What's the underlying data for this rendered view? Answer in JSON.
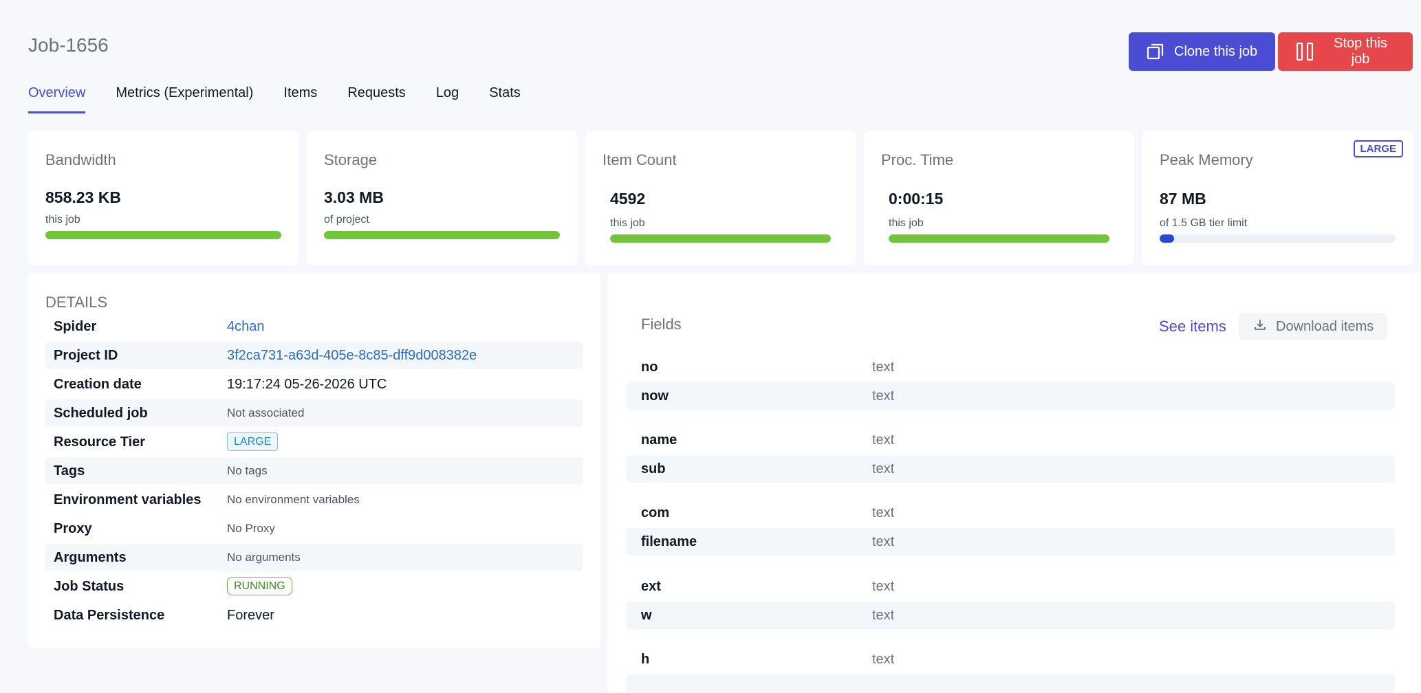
{
  "header": {
    "title": "Job-1656",
    "clone_label": "Clone this job",
    "stop_label": "Stop this job"
  },
  "tabs": [
    {
      "label": "Overview",
      "active": true
    },
    {
      "label": "Metrics (Experimental)"
    },
    {
      "label": "Items"
    },
    {
      "label": "Requests"
    },
    {
      "label": "Log"
    },
    {
      "label": "Stats"
    }
  ],
  "stats": {
    "bandwidth": {
      "title": "Bandwidth",
      "value": "858.23 KB",
      "sub": "this job",
      "progress": 1.0
    },
    "storage": {
      "title": "Storage",
      "value": "3.03 MB",
      "sub": "of project",
      "progress": 1.0
    },
    "item_count": {
      "title": "Item Count",
      "value": "4592",
      "sub": "this job",
      "progress": 1.0
    },
    "proc_time": {
      "title": "Proc. Time",
      "value": "0:00:15",
      "sub": "this job",
      "progress": 1.0
    },
    "peak_memory": {
      "title": "Peak Memory",
      "value": "87 MB",
      "sub": "of 1.5 GB tier limit",
      "progress": 0.06,
      "badge": "LARGE"
    }
  },
  "details": {
    "title": "DETAILS",
    "rows": [
      {
        "label": "Spider",
        "value": "4chan"
      },
      {
        "label": "Project ID",
        "value": "3f2ca731-a63d-405e-8c85-dff9d008382e"
      },
      {
        "label": "Creation date",
        "value": "19:17:24 05-26-2026 UTC"
      },
      {
        "label": "Scheduled job",
        "value": "Not associated"
      },
      {
        "label": "Resource Tier",
        "value": "LARGE"
      },
      {
        "label": "Tags",
        "value": "No tags"
      },
      {
        "label": "Environment variables",
        "value": "No environment variables"
      },
      {
        "label": "Proxy",
        "value": "No Proxy"
      },
      {
        "label": "Arguments",
        "value": "No arguments"
      },
      {
        "label": "Job Status",
        "value": "RUNNING"
      },
      {
        "label": "Data Persistence",
        "value": "Forever"
      }
    ]
  },
  "fields": {
    "title": "Fields",
    "see_items_label": "See items",
    "download_label": "Download items",
    "rows": [
      {
        "name": "no",
        "type": "text"
      },
      {
        "name": "now",
        "type": "text"
      },
      {
        "name": "name",
        "type": "text"
      },
      {
        "name": "sub",
        "type": "text"
      },
      {
        "name": "com",
        "type": "text"
      },
      {
        "name": "filename",
        "type": "text"
      },
      {
        "name": "ext",
        "type": "text"
      },
      {
        "name": "w",
        "type": "text"
      },
      {
        "name": "h",
        "type": "text"
      }
    ]
  },
  "colors": {
    "accent": "#4a4dd4",
    "danger": "#e5474a",
    "progress_green": "#72c53a",
    "progress_blue": "#2945d1",
    "running_green": "#3c8a26"
  },
  "icons": {
    "clone": "clone-icon",
    "stop": "stop-icon",
    "download": "download-icon"
  }
}
